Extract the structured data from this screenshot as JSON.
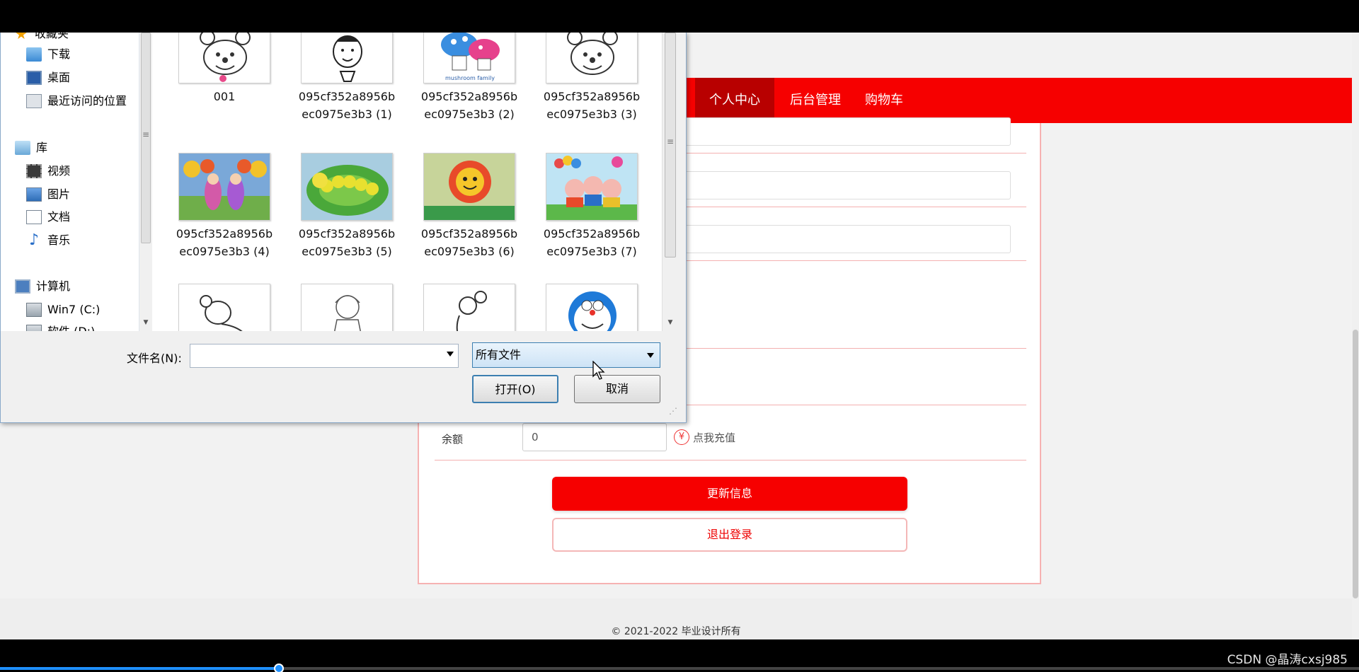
{
  "nav": {
    "items": [
      {
        "label": "个人中心",
        "active": true
      },
      {
        "label": "后台管理",
        "active": false
      },
      {
        "label": "购物车",
        "active": false
      }
    ]
  },
  "profile": {
    "balance_label": "余额",
    "balance_value": "0",
    "recharge_text": "点我充值",
    "update_button": "更新信息",
    "logout_button": "退出登录"
  },
  "footer": {
    "text": "© 2021-2022 毕业设计所有"
  },
  "dialog": {
    "sidebar": {
      "items": [
        {
          "label": "收藏夹",
          "icon": "star-icon"
        },
        {
          "label": "下载",
          "icon": "downloads-folder-icon"
        },
        {
          "label": "桌面",
          "icon": "desktop-icon"
        },
        {
          "label": "最近访问的位置",
          "icon": "recent-places-icon"
        },
        {
          "label": "库",
          "icon": "library-icon"
        },
        {
          "label": "视频",
          "icon": "video-icon"
        },
        {
          "label": "图片",
          "icon": "pictures-icon"
        },
        {
          "label": "文档",
          "icon": "documents-icon"
        },
        {
          "label": "音乐",
          "icon": "music-icon"
        },
        {
          "label": "计算机",
          "icon": "computer-icon"
        },
        {
          "label": "Win7 (C:)",
          "icon": "drive-icon"
        },
        {
          "label": "软件 (D:)",
          "icon": "drive-icon"
        }
      ]
    },
    "files": [
      {
        "name": "001"
      },
      {
        "name": "095cf352a8956bec0975e3b3 (1)"
      },
      {
        "name": "095cf352a8956bec0975e3b3 (2)"
      },
      {
        "name": "095cf352a8956bec0975e3b3 (3)"
      },
      {
        "name": "095cf352a8956bec0975e3b3 (4)"
      },
      {
        "name": "095cf352a8956bec0975e3b3 (5)"
      },
      {
        "name": "095cf352a8956bec0975e3b3 (6)"
      },
      {
        "name": "095cf352a8956bec0975e3b3 (7)"
      },
      {
        "name": ""
      },
      {
        "name": ""
      },
      {
        "name": ""
      },
      {
        "name": ""
      }
    ],
    "filename_label": "文件名(N):",
    "filename_value": "",
    "filetype_selected": "所有文件",
    "open_button": "打开(O)",
    "cancel_button": "取消"
  },
  "video": {
    "progress_fraction": 0.205,
    "watermark": "CSDN @晶涛cxsj985"
  },
  "colors": {
    "accent": "#f60000",
    "nav_active": "#b80000",
    "progress": "#1e90ff"
  }
}
